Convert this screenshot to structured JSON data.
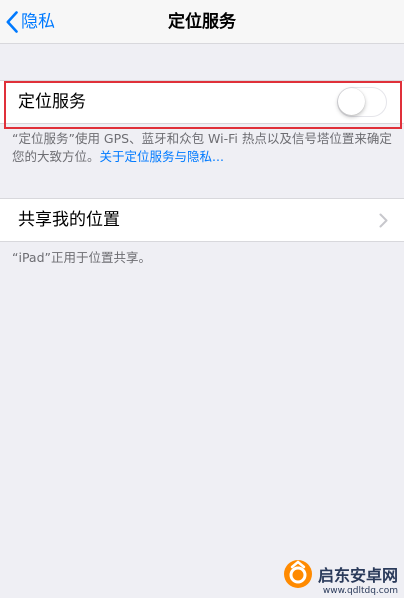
{
  "nav": {
    "back_label": "隐私",
    "title": "定位服务"
  },
  "location_services": {
    "label": "定位服务",
    "enabled": false,
    "description": "“定位服务”使用 GPS、蓝牙和众包 Wi-Fi 热点以及信号塔位置来确定您的大致方位。",
    "link": "关于定位服务与隐私..."
  },
  "share_location": {
    "label": "共享我的位置",
    "note": "“iPad”正用于位置共享。"
  },
  "watermark": {
    "text": "启东安卓网",
    "url": "www.qdltdq.com"
  },
  "colors": {
    "accent": "#007aff",
    "highlight": "#e0303a",
    "background": "#efeff4"
  },
  "icons": {
    "back": "chevron-left-icon",
    "share_row": "chevron-right-icon",
    "watermark": "logo-icon"
  }
}
